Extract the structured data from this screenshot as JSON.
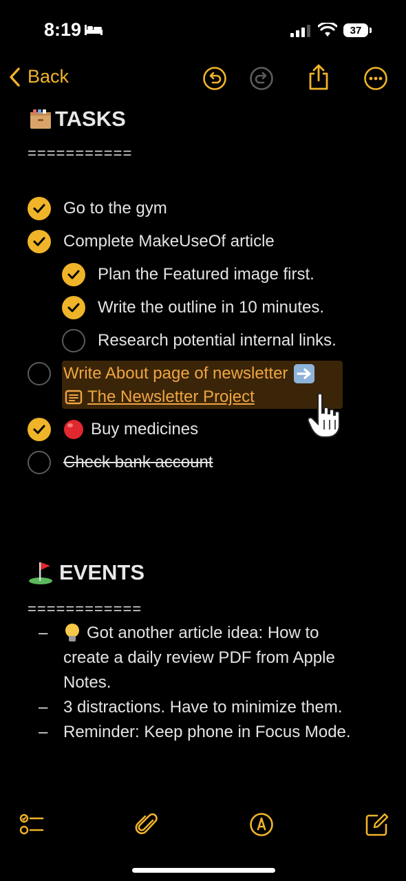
{
  "status": {
    "time": "8:19",
    "battery": "37"
  },
  "nav": {
    "back_label": "Back"
  },
  "tasks": {
    "heading": "TASKS",
    "divider": "===========",
    "items": [
      {
        "label": "Go to the gym",
        "checked": true
      },
      {
        "label": "Complete MakeUseOf article",
        "checked": true
      },
      {
        "label": "Plan the Featured image first.",
        "checked": true
      },
      {
        "label": "Write the outline in 10 minutes.",
        "checked": true
      },
      {
        "label": "Research potential internal links.",
        "checked": false
      },
      {
        "label": "Write About page of newsletter",
        "checked": false,
        "link": "The Newsletter Project"
      },
      {
        "label": "Buy medicines",
        "checked": true
      },
      {
        "label": "Check bank account",
        "checked": false,
        "struck": true
      }
    ]
  },
  "events": {
    "heading": "EVENTS",
    "divider": "============",
    "items": [
      {
        "line1": "Got another article idea: How to",
        "line2": "create a daily review PDF from Apple",
        "line3": "Notes."
      },
      {
        "text": "3 distractions. Have to minimize them."
      },
      {
        "text": "Reminder: Keep phone in Focus Mode."
      }
    ]
  },
  "accent_color": "#f0b429"
}
